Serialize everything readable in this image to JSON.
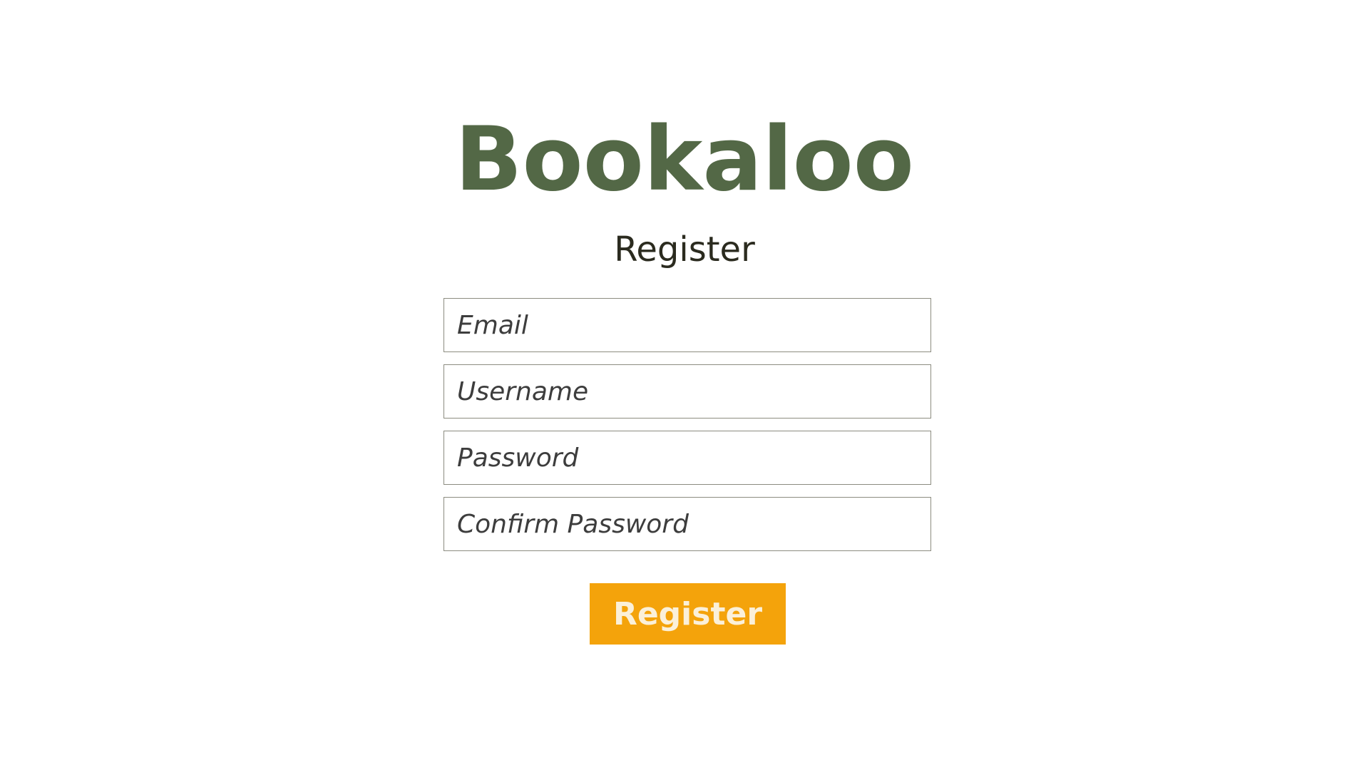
{
  "brand": {
    "name": "Bookaloo",
    "color": "#536846"
  },
  "form": {
    "heading": "Register",
    "fields": {
      "email_placeholder": "Email",
      "username_placeholder": "Username",
      "password_placeholder": "Password",
      "confirm_password_placeholder": "Confirm Password"
    },
    "submit_label": "Register",
    "submit_color": "#f4a30b"
  }
}
